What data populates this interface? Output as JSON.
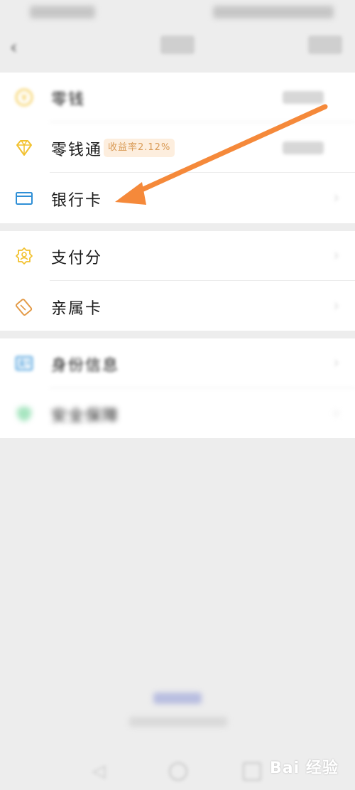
{
  "list": {
    "wallet_label": "零钱",
    "wallet_value": "",
    "lqt_label": "零钱通",
    "lqt_badge": "收益率2.12%",
    "lqt_value": "",
    "bankcard_label": "银行卡",
    "payscore_label": "支付分",
    "family_card_label": "亲属卡",
    "identity_label": "身份信息",
    "security_label": "安全保障"
  },
  "watermark": "Bai 经验",
  "icons": {
    "wallet": "yuan-coin-icon",
    "lqt": "diamond-icon",
    "bankcard": "bank-card-icon",
    "payscore": "score-badge-icon",
    "family_card": "family-card-icon",
    "identity": "id-card-icon",
    "security": "shield-icon"
  },
  "colors": {
    "arrow": "#f5893a",
    "badge_bg": "#fdeede",
    "badge_text": "#d99a55",
    "icon_yellow": "#f2c12e",
    "icon_blue": "#2f8fd6",
    "icon_orange": "#e39a47",
    "icon_green": "#5fd08d"
  }
}
